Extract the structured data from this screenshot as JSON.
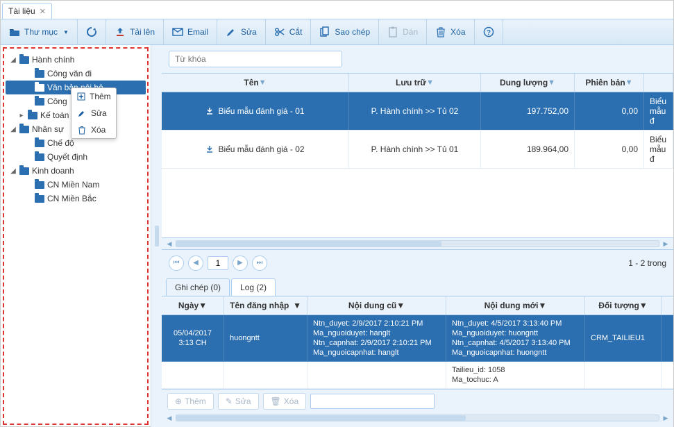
{
  "tab": {
    "label": "Tài liệu"
  },
  "toolbar": {
    "folder": "Thư mục",
    "upload": "Tải lên",
    "email": "Email",
    "edit": "Sửa",
    "cut": "Cắt",
    "copy": "Sao chép",
    "paste": "Dán",
    "delete": "Xóa"
  },
  "tree": {
    "hanhchinh": "Hành chính",
    "congvandi": "Công văn đi",
    "vanban": "Văn bản nội bộ",
    "cong": "Công",
    "ketoan": "Kế toán",
    "nhansu": "Nhân sự",
    "chedo": "Chế độ",
    "quyetdinh": "Quyết định",
    "kinhdoanh": "Kinh doanh",
    "cnmb": "CN Miền Bắc",
    "cnmn": "CN Miền Nam"
  },
  "ctx": {
    "add": "Thêm",
    "edit": "Sửa",
    "delete": "Xóa"
  },
  "search": {
    "placeholder": "Từ khóa"
  },
  "gridHeaders": {
    "name": "Tên",
    "store": "Lưu trữ",
    "size": "Dung lượng",
    "ver": "Phiên bản",
    "desc": ""
  },
  "rows": [
    {
      "name": "Biểu mẫu đánh giá - 01",
      "store": "P. Hành chính >> Tủ 02",
      "size": "197.752,00",
      "ver": "0,00",
      "desc": "Biểu mẫu đ"
    },
    {
      "name": "Biểu mẫu đánh giá - 02",
      "store": "P. Hành chính >> Tủ 01",
      "size": "189.964,00",
      "ver": "0,00",
      "desc": "Biểu mẫu đ"
    }
  ],
  "pager": {
    "page": "1",
    "summary": "1 - 2 trong"
  },
  "subTabs": {
    "notes": "Ghi chép (0)",
    "log": "Log (2)"
  },
  "logHeaders": {
    "date": "Ngày",
    "user": "Tên đăng nhập",
    "old": "Nội dung cũ",
    "new": "Nội dung mới",
    "obj": "Đối tượng"
  },
  "log": {
    "row1": {
      "date1": "05/04/2017",
      "date2": "3:13 CH",
      "user": "huongntt",
      "old": [
        "Ntn_duyet: 2/9/2017 2:10:21 PM",
        "Ma_nguoiduyet: hanglt",
        "Ntn_capnhat: 2/9/2017 2:10:21 PM",
        "Ma_nguoicapnhat: hanglt"
      ],
      "new": [
        "Ntn_duyet: 4/5/2017 3:13:40 PM",
        "Ma_nguoiduyet: huongntt",
        "Ntn_capnhat: 4/5/2017 3:13:40 PM",
        "Ma_nguoicapnhat: huongntt"
      ],
      "obj": "CRM_TAILIEU1"
    },
    "row2": {
      "new": [
        "Tailieu_id: 1058",
        "Ma_tochuc: A"
      ]
    }
  },
  "logToolbar": {
    "add": "Thêm",
    "edit": "Sửa",
    "delete": "Xóa"
  }
}
